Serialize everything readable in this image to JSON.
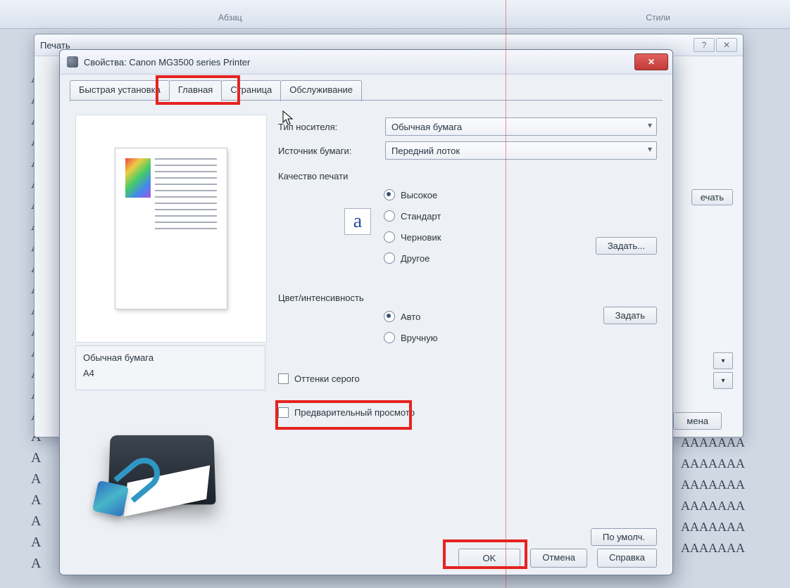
{
  "ribbon": {
    "paragraph": "Абзац",
    "styles": "Стили"
  },
  "bg_doc": {
    "left_col_char": "А",
    "left_col_rows": 24,
    "right_rows": [
      "ААААААА",
      "ААААААА",
      "ААААААА",
      "ААААААА",
      "ААААААА",
      "ААААААА"
    ]
  },
  "print_dialog": {
    "title": "Печать",
    "side_btn_print": "ечать",
    "cancel": "мена"
  },
  "props": {
    "title": "Свойства: Canon MG3500 series Printer",
    "tabs": {
      "quick": "Быстрая установка",
      "main": "Главная",
      "page": "Страница",
      "service": "Обслуживание"
    },
    "active_tab_index": 1,
    "media_label": "Тип носителя:",
    "media_value": "Обычная бумага",
    "source_label": "Источник бумаги:",
    "source_value": "Передний лоток",
    "quality_label": "Качество печати",
    "quality_options": {
      "high": "Высокое",
      "std": "Стандарт",
      "draft": "Черновик",
      "other": "Другое"
    },
    "quality_selected": "high",
    "set_btn": "Задать...",
    "set_btn2": "Задать",
    "color_label": "Цвет/интенсивность",
    "color_auto": "Авто",
    "color_manual": "Вручную",
    "color_selected": "auto",
    "grayscale": "Оттенки серого",
    "preview_print": "Предварительный просмотр",
    "defaults": "По умолч.",
    "paper_info_line1": "Обычная бумага",
    "paper_info_line2": "A4",
    "ok": "OK",
    "cancel": "Отмена",
    "help": "Справка",
    "quality_badge": "a"
  }
}
